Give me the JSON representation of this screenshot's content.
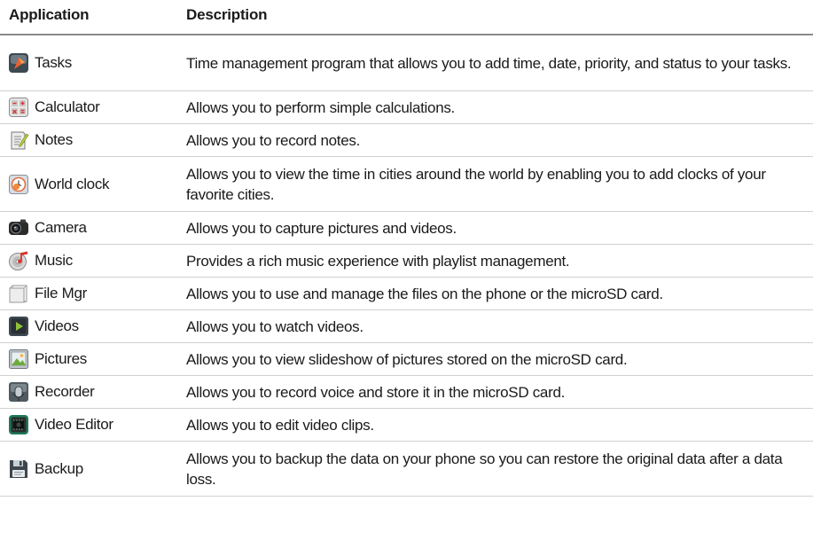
{
  "headers": {
    "application": "Application",
    "description": "Description"
  },
  "rows": [
    {
      "name": "Tasks",
      "icon": "tasks-icon",
      "description": "Time management program that allows you to add time, date, priority, and status to your tasks."
    },
    {
      "name": "Calculator",
      "icon": "calculator-icon",
      "description": "Allows you to perform simple calculations."
    },
    {
      "name": "Notes",
      "icon": "notes-icon",
      "description": "Allows you to record notes."
    },
    {
      "name": "World clock",
      "icon": "world-clock-icon",
      "description": "Allows you to view the time in cities around the world by enabling you to add clocks of your favorite cities."
    },
    {
      "name": "Camera",
      "icon": "camera-icon",
      "description": "Allows you to capture pictures and videos."
    },
    {
      "name": "Music",
      "icon": "music-icon",
      "description": "Provides a rich music experience with playlist management."
    },
    {
      "name": "File Mgr",
      "icon": "file-manager-icon",
      "description": "Allows you to use and manage the files on the phone or the microSD card."
    },
    {
      "name": "Videos",
      "icon": "videos-icon",
      "description": "Allows you to watch videos."
    },
    {
      "name": "Pictures",
      "icon": "pictures-icon",
      "description": "Allows you to view slideshow of pictures stored on the microSD card."
    },
    {
      "name": "Recorder",
      "icon": "recorder-icon",
      "description": "Allows you to record voice and store it in the microSD card."
    },
    {
      "name": "Video Editor",
      "icon": "video-editor-icon",
      "description": "Allows you to edit video clips."
    },
    {
      "name": "Backup",
      "icon": "backup-icon",
      "description": "Allows you to backup the data on your phone so you can restore the original data after a data loss."
    }
  ]
}
